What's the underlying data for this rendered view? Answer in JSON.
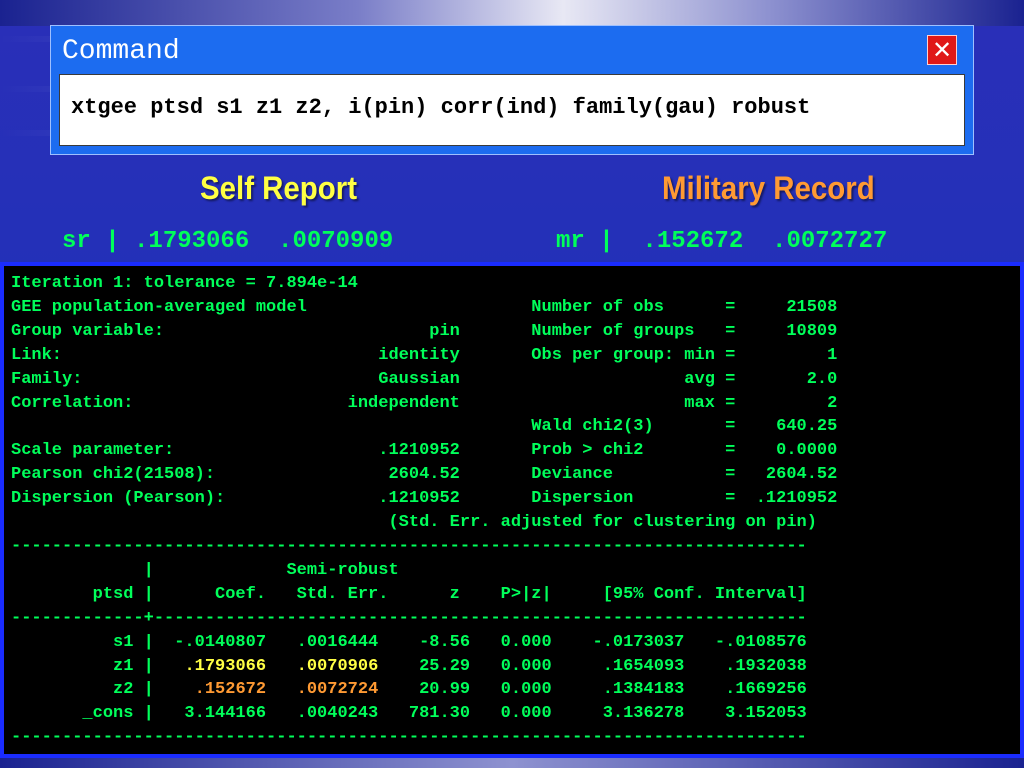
{
  "command_window": {
    "title": "Command",
    "close_icon": "close-icon",
    "command_text": "xtgee ptsd s1 z1 z2, i(pin) corr(ind) family(gau) robust"
  },
  "headings": {
    "self_report": "Self Report",
    "military_record": "Military Record"
  },
  "estimates": {
    "sr_line": "sr | .1793066  .0070909",
    "mr_line": "mr |  .152672  .0072727"
  },
  "results": {
    "lines": [
      "Iteration 1: tolerance = 7.894e-14",
      "GEE population-averaged model                      Number of obs      =     21508",
      "Group variable:                          pin       Number of groups   =     10809",
      "Link:                               identity       Obs per group: min =         1",
      "Family:                             Gaussian                      avg =       2.0",
      "Correlation:                     independent                      max =         2",
      "                                                   Wald chi2(3)       =    640.25",
      "Scale parameter:                    .1210952       Prob > chi2        =    0.0000",
      "Pearson chi2(21508):                 2604.52       Deviance           =   2604.52",
      "Dispersion (Pearson):               .1210952       Dispersion         =  .1210952",
      "                                     (Std. Err. adjusted for clustering on pin)",
      "------------------------------------------------------------------------------",
      "             |             Semi-robust",
      "        ptsd |      Coef.   Std. Err.      z    P>|z|     [95% Conf. Interval]",
      "-------------+----------------------------------------------------------------",
      "          s1 |  -.0140807   .0016444    -8.56   0.000    -.0173037   -.0108576"
    ],
    "z1": {
      "pre": "          z1 |   ",
      "coef": ".1793066",
      "mid": "   ",
      "se": ".0070906",
      "post": "    25.29   0.000     .1654093    .1932038"
    },
    "z2": {
      "pre": "          z2 |    ",
      "coef": ".152672",
      "mid": "   ",
      "se": ".0072724",
      "post": "    20.99   0.000     .1384183    .1669256"
    },
    "tail_lines": [
      "       _cons |   3.144166   .0040243   781.30   0.000     3.136278    3.152053",
      "------------------------------------------------------------------------------"
    ]
  }
}
